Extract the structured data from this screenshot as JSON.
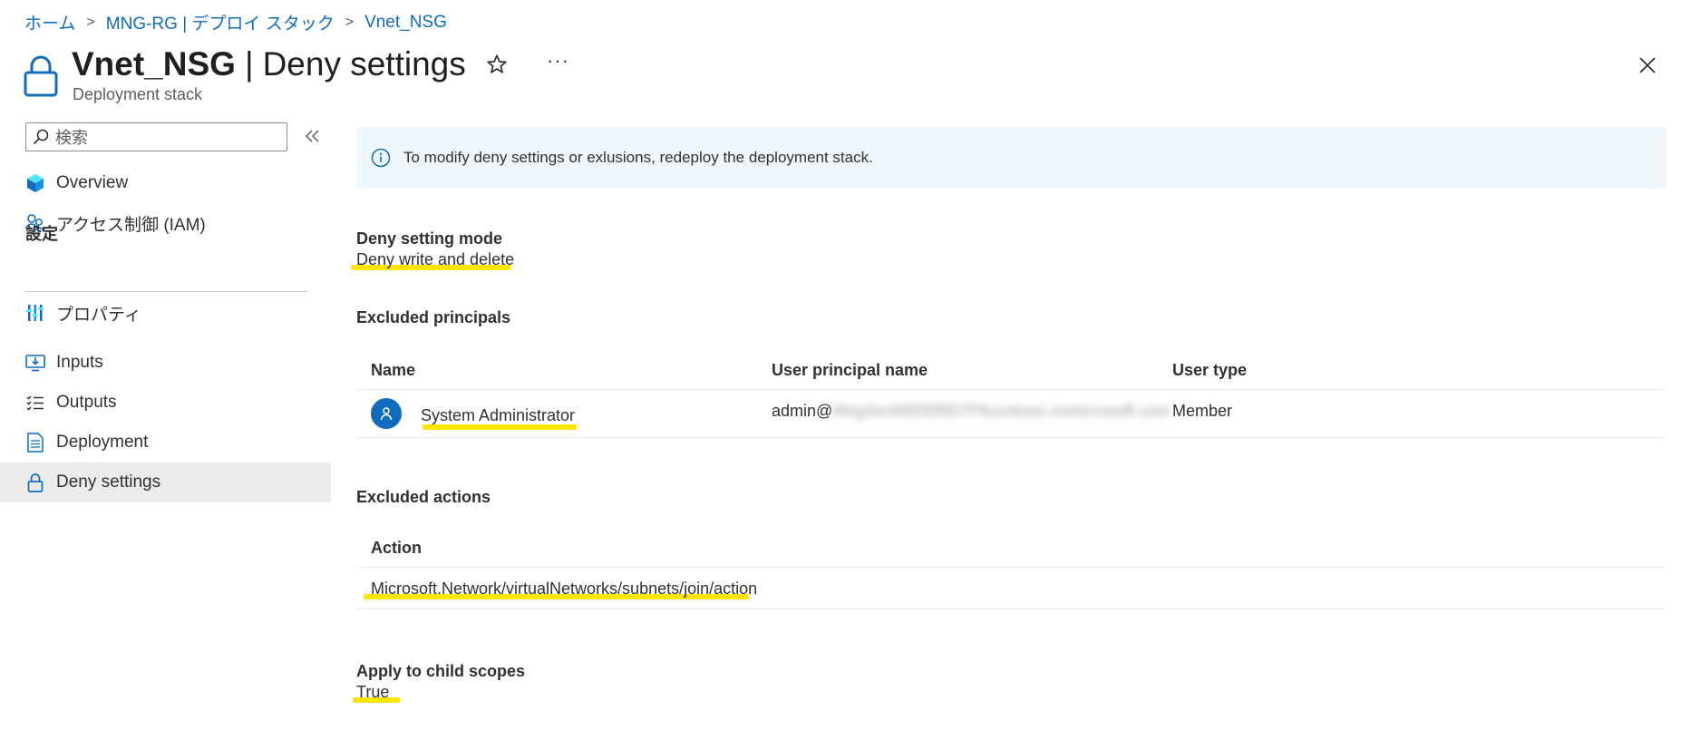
{
  "breadcrumb": {
    "items": [
      {
        "label": "ホーム"
      },
      {
        "label": "MNG-RG | デプロイ スタック"
      },
      {
        "label": "Vnet_NSG"
      }
    ]
  },
  "header": {
    "resource_name": "Vnet_NSG",
    "page_name": "Deny settings",
    "separator": "|",
    "subtitle": "Deployment stack",
    "more_label": "···"
  },
  "sidebar": {
    "search_placeholder": "検索",
    "group_label": "設定",
    "items": [
      {
        "label": "Overview",
        "icon": "cube-icon"
      },
      {
        "label": "アクセス制御 (IAM)",
        "icon": "people-icon"
      },
      {
        "label": "プロパティ",
        "icon": "properties-icon"
      },
      {
        "label": "Inputs",
        "icon": "inputs-icon"
      },
      {
        "label": "Outputs",
        "icon": "outputs-icon"
      },
      {
        "label": "Deployment",
        "icon": "document-icon"
      },
      {
        "label": "Deny settings",
        "icon": "lock-icon",
        "active": true
      }
    ]
  },
  "main": {
    "info_text": "To modify deny settings or exlusions, redeploy the deployment stack.",
    "deny_mode": {
      "label": "Deny setting mode",
      "value": "Deny write and delete"
    },
    "excluded_principals": {
      "label": "Excluded principals",
      "columns": [
        "Name",
        "User principal name",
        "User type"
      ],
      "rows": [
        {
          "name": "System Administrator",
          "upn_prefix": "admin@",
          "upn_hidden": "MngSvcM0D0f9D7F6contoso.onmicrosoft.com",
          "type": "Member"
        }
      ]
    },
    "excluded_actions": {
      "label": "Excluded actions",
      "columns": [
        "Action"
      ],
      "rows": [
        {
          "action": "Microsoft.Network/virtualNetworks/subnets/join/action"
        }
      ]
    },
    "child_scopes": {
      "label": "Apply to child scopes",
      "value": "True"
    }
  },
  "colors": {
    "accent": "#0f6cbd",
    "info_background": "#eff6fc",
    "highlight": "#ffe500",
    "active_nav": "#edebe9"
  }
}
